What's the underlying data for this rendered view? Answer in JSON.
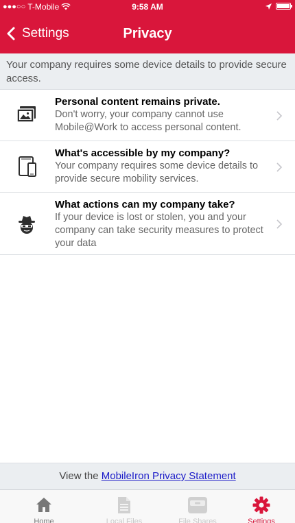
{
  "status_bar": {
    "signal": "●●●○○",
    "carrier": "T-Mobile",
    "time": "9:58 AM"
  },
  "nav": {
    "back_label": "Settings",
    "title": "Privacy"
  },
  "notice": "Your company requires some device details to provide secure access.",
  "items": [
    {
      "title": "Personal content remains private.",
      "description": "Don't worry, your company cannot use Mobile@Work to access personal content.",
      "icon": "photo-icon"
    },
    {
      "title": "What's accessible by my company?",
      "description": "Your company requires some device details to provide secure mobility services.",
      "icon": "devices-icon"
    },
    {
      "title": "What actions can my company take?",
      "description": "If your device is lost or stolen, you and your company can take security measures to protect your data",
      "icon": "spy-icon"
    }
  ],
  "footer": {
    "prefix": "View the ",
    "link_text": "MobileIron Privacy Statement"
  },
  "tabs": [
    {
      "label": "Home",
      "icon": "home-icon",
      "state": "normal"
    },
    {
      "label": "Local Files",
      "icon": "document-icon",
      "state": "disabled"
    },
    {
      "label": "File Shares",
      "icon": "archive-icon",
      "state": "disabled"
    },
    {
      "label": "Settings",
      "icon": "gear-icon",
      "state": "selected"
    }
  ],
  "colors": {
    "brand_red": "#d9163b",
    "link_blue": "#1a1ac8",
    "notice_bg": "#ebeef1"
  }
}
